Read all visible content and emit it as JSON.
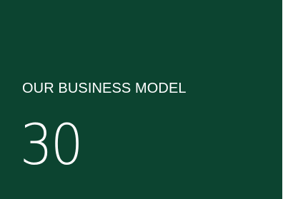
{
  "section": {
    "title": "OUR BUSINESS MODEL",
    "page_number": "30"
  },
  "colors": {
    "background": "#0c4430",
    "text": "#ffffff"
  }
}
